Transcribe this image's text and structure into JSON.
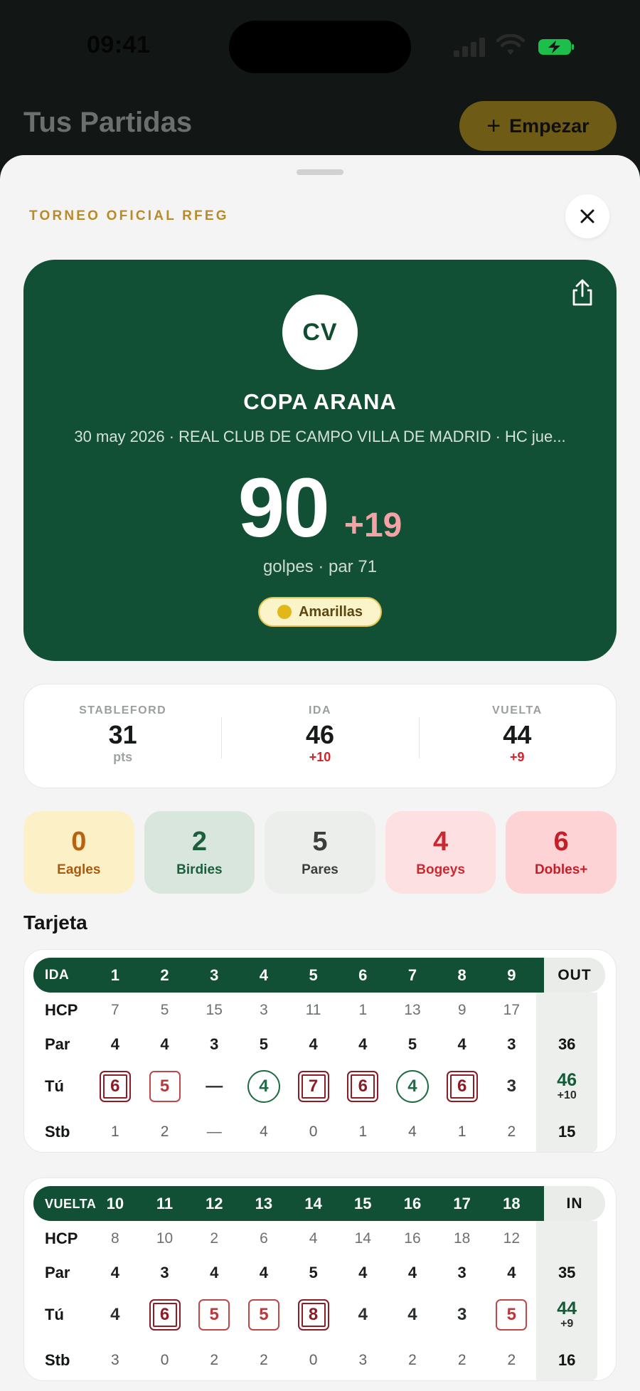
{
  "status_bar": {
    "time": "09:41"
  },
  "background": {
    "title": "Tus Partidas",
    "start_label": "Empezar"
  },
  "sheet": {
    "eyebrow": "TORNEO OFICIAL RFEG",
    "hero": {
      "initials": "CV",
      "title": "COPA ARANA",
      "subtitle": "30 may 2026 · REAL CLUB DE CAMPO VILLA DE MADRID · HC jue...",
      "score": "90",
      "over_par": "+19",
      "note": "golpes · par 71",
      "tee": "Amarillas"
    },
    "summary": [
      {
        "label": "STABLEFORD",
        "value": "31",
        "sub": "pts"
      },
      {
        "label": "IDA",
        "value": "46",
        "sub": "+10"
      },
      {
        "label": "VUELTA",
        "value": "44",
        "sub": "+9"
      }
    ],
    "categories": [
      {
        "count": "0",
        "label": "Eagles"
      },
      {
        "count": "2",
        "label": "Birdies"
      },
      {
        "count": "5",
        "label": "Pares"
      },
      {
        "count": "4",
        "label": "Bogeys"
      },
      {
        "count": "6",
        "label": "Dobles+"
      }
    ],
    "section_title": "Tarjeta",
    "row_labels": {
      "hcp": "HCP",
      "par": "Par",
      "you": "Tú",
      "stb": "Stb"
    },
    "front": {
      "label": "IDA",
      "total_label": "OUT",
      "holes": [
        "1",
        "2",
        "3",
        "4",
        "5",
        "6",
        "7",
        "8",
        "9"
      ],
      "hcp": [
        "7",
        "5",
        "15",
        "3",
        "11",
        "1",
        "13",
        "9",
        "17"
      ],
      "par": [
        "4",
        "4",
        "3",
        "5",
        "4",
        "4",
        "5",
        "4",
        "3"
      ],
      "strokes": [
        "6",
        "5",
        "—",
        "4",
        "7",
        "6",
        "4",
        "6",
        "3"
      ],
      "stb": [
        "1",
        "2",
        "—",
        "4",
        "0",
        "1",
        "4",
        "1",
        "2"
      ],
      "par_total": "36",
      "strokes_total": "46",
      "strokes_diff": "+10",
      "stb_total": "15"
    },
    "back": {
      "label": "VUELTA",
      "total_label": "IN",
      "holes": [
        "10",
        "11",
        "12",
        "13",
        "14",
        "15",
        "16",
        "17",
        "18"
      ],
      "hcp": [
        "8",
        "10",
        "2",
        "6",
        "4",
        "14",
        "16",
        "18",
        "12"
      ],
      "par": [
        "4",
        "3",
        "4",
        "4",
        "5",
        "4",
        "4",
        "3",
        "4"
      ],
      "strokes": [
        "4",
        "6",
        "5",
        "5",
        "8",
        "4",
        "4",
        "3",
        "5"
      ],
      "stb": [
        "3",
        "0",
        "2",
        "2",
        "0",
        "3",
        "2",
        "2",
        "2"
      ],
      "par_total": "35",
      "strokes_total": "44",
      "strokes_diff": "+9",
      "stb_total": "16"
    }
  },
  "colors": {
    "brand_green": "#115034",
    "accent_gold": "#b98a2a",
    "over_par": "#f4a2a6",
    "bogey": "#c04848",
    "double_bogey": "#8c1c26",
    "birdie": "#1f6b45",
    "chip_eagles": "#fcf1c6",
    "chip_birdies": "#d8e6dd",
    "chip_pares": "#eceeec",
    "chip_bogeys": "#fde0e1",
    "chip_dobles": "#fdd3d5"
  },
  "icons": {
    "close": "close-icon",
    "share": "share-icon",
    "plus": "plus-icon",
    "tee_dot": "tee-color-dot"
  }
}
